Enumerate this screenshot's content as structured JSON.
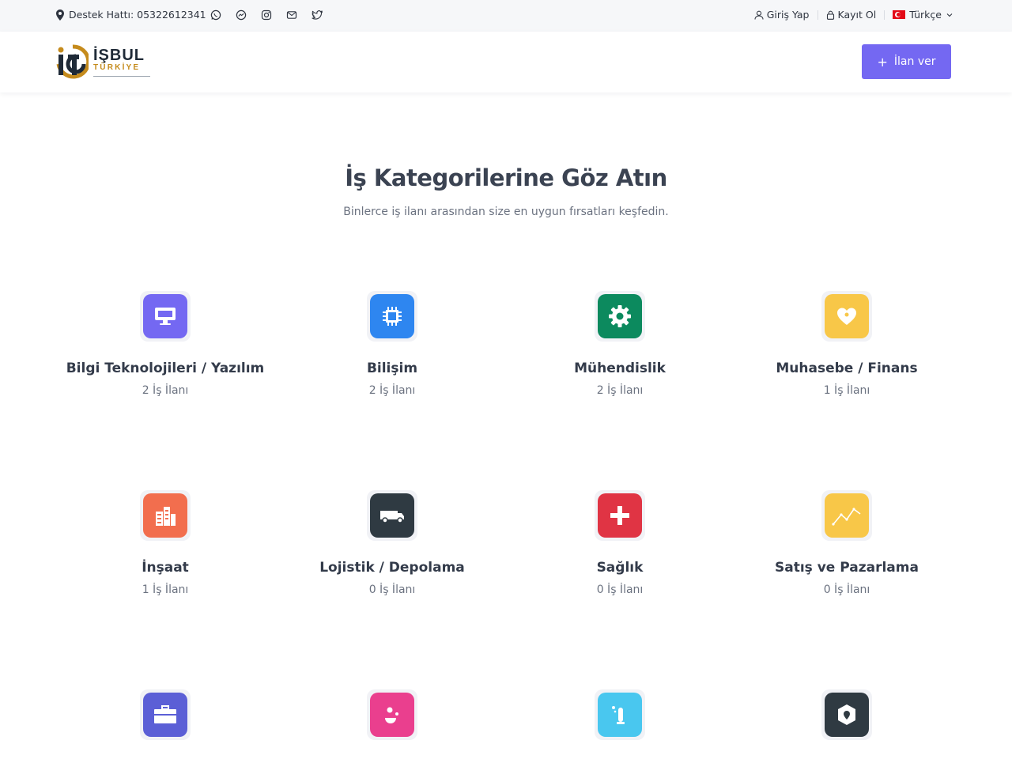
{
  "topbar": {
    "support": "Destek Hattı: 05322612341",
    "socials": [
      "whatsapp-icon",
      "messenger-icon",
      "instagram-icon",
      "mail-icon",
      "twitter-icon"
    ],
    "login": "Giriş Yap",
    "register": "Kayıt Ol",
    "language": "Türkçe"
  },
  "nav": {
    "logo_brand": "İŞBUL",
    "logo_country": "TÜRKİYE",
    "post_button": "İlan ver"
  },
  "hero": {
    "title": "İş Kategorilerine Göz Atın",
    "subtitle": "Binlerce iş ilanı arasından size en uygun fırsatları keşfedin."
  },
  "colors": {
    "accent": "#7468f2",
    "topbar_bg": "#f6f7f9"
  },
  "categories": [
    {
      "name": "Bilgi Teknolojileri / Yazılım",
      "count": "2 İş İlanı",
      "icon": "monitor-icon",
      "color": "#7468f2"
    },
    {
      "name": "Bilişim",
      "count": "2 İş İlanı",
      "icon": "chip-icon",
      "color": "#2e86f0"
    },
    {
      "name": "Mühendislik",
      "count": "2 İş İlanı",
      "icon": "gear-icon",
      "color": "#0c8a5e"
    },
    {
      "name": "Muhasebe / Finans",
      "count": "1 İş İlanı",
      "icon": "heart-coin-icon",
      "color": "#f8c748"
    },
    {
      "name": "İnşaat",
      "count": "1 İş İlanı",
      "icon": "building-icon",
      "color": "#f26e4e"
    },
    {
      "name": "Lojistik / Depolama",
      "count": "0 İş İlanı",
      "icon": "truck-icon",
      "color": "#2f3a42"
    },
    {
      "name": "Sağlık",
      "count": "0 İş İlanı",
      "icon": "medical-cross-icon",
      "color": "#e03444"
    },
    {
      "name": "Satış ve Pazarlama",
      "count": "0 İş İlanı",
      "icon": "chart-line-icon",
      "color": "#f8c748"
    },
    {
      "name": "",
      "count": "",
      "icon": "briefcase-icon",
      "color": "#5b5fd6"
    },
    {
      "name": "",
      "count": "",
      "icon": "face-icon",
      "color": "#ea3f8e"
    },
    {
      "name": "",
      "count": "",
      "icon": "lab-tube-icon",
      "color": "#49c7ef"
    },
    {
      "name": "",
      "count": "",
      "icon": "shield-icon",
      "color": "#2f3a42"
    }
  ]
}
